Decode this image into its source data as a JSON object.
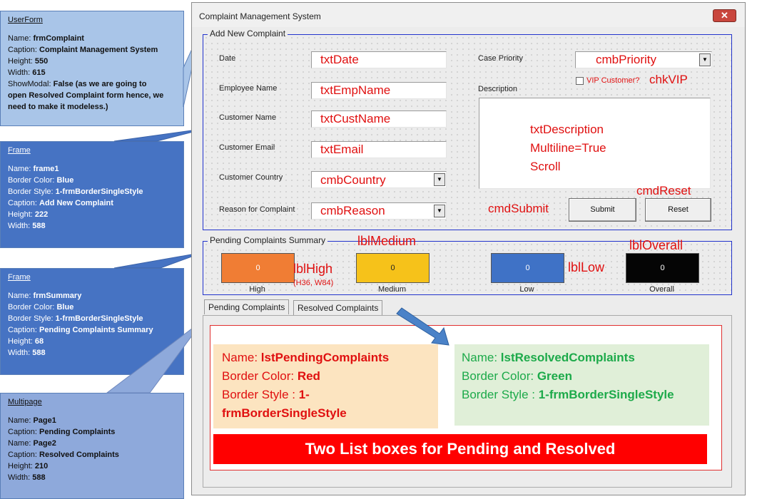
{
  "callouts": {
    "userform": {
      "title": "UserForm",
      "rows": [
        {
          "k": "Name: ",
          "v": "frmComplaint"
        },
        {
          "k": "Caption: ",
          "v": "Complaint Management System"
        },
        {
          "k": "Height: ",
          "v": "550"
        },
        {
          "k": "Width: ",
          "v": "615"
        },
        {
          "k": "ShowModal: ",
          "v": "False (as we are going to"
        },
        {
          "k": "",
          "v": "open Resolved Complaint form hence, we"
        },
        {
          "k": "",
          "v": "need to make it modeless.)"
        }
      ]
    },
    "frame1": {
      "title": "Frame",
      "rows": [
        {
          "k": "Name: ",
          "v": "frame1"
        },
        {
          "k": "Border Color: ",
          "v": "Blue"
        },
        {
          "k": "Border Style: ",
          "v": "1-frmBorderSingleStyle"
        },
        {
          "k": "Caption: ",
          "v": "Add New Complaint"
        },
        {
          "k": "Height:   ",
          "v": "222"
        },
        {
          "k": "Width:   ",
          "v": "588"
        }
      ]
    },
    "frmsummary": {
      "title": "Frame",
      "rows": [
        {
          "k": "Name: ",
          "v": "frmSummary"
        },
        {
          "k": "Border Color: ",
          "v": "Blue"
        },
        {
          "k": "Border Style: ",
          "v": "1-frmBorderSingleStyle"
        },
        {
          "k": "Caption: ",
          "v": "Pending Complaints Summary"
        },
        {
          "k": "Height:   ",
          "v": "68"
        },
        {
          "k": "Width:   ",
          "v": "588"
        }
      ]
    },
    "multipage": {
      "title": "Multipage",
      "rows": [
        {
          "k": "Name: ",
          "v": "Page1"
        },
        {
          "k": "Caption: ",
          "v": "Pending Complaints"
        },
        {
          "k": "Name: ",
          "v": "Page2"
        },
        {
          "k": "Caption: ",
          "v": "Resolved Complaints"
        },
        {
          "k": "Height:   ",
          "v": "210"
        },
        {
          "k": "Width:   ",
          "v": "588"
        }
      ]
    }
  },
  "form": {
    "title": "Complaint Management System",
    "close_symbol": "✕",
    "frame1_caption": "Add New Complaint",
    "labels": {
      "date": "Date",
      "emp": "Employee Name",
      "cust": "Customer Name",
      "email": "Customer Email",
      "country": "Customer Country",
      "reason": "Reason for Complaint",
      "priority": "Case Priority",
      "vip": "VIP Customer?",
      "desc": "Description"
    },
    "controls": {
      "txtDate": "txtDate",
      "txtEmpName": "txtEmpName",
      "txtCustName": "txtCustName",
      "txtEmail": "txtEmail",
      "cmbCountry": "cmbCountry",
      "cmbReason": "cmbReason",
      "cmbPriority": "cmbPriority",
      "chkVIP": "chkVIP",
      "desc_line1": "txtDescription",
      "desc_line2": "Multiline=True",
      "desc_line3": "Scroll",
      "cmdSubmit": "cmdSubmit",
      "cmdReset": "cmdReset"
    },
    "buttons": {
      "submit": "Submit",
      "reset": "Reset"
    },
    "summary": {
      "caption": "Pending Complaints Summary",
      "tiles": [
        {
          "caption": "High",
          "value": "0",
          "color": "#f07d34"
        },
        {
          "caption": "Medium",
          "value": "0",
          "color": "#f6c21a"
        },
        {
          "caption": "Low",
          "value": "0",
          "color": "#3f72c6"
        },
        {
          "caption": "Overall",
          "value": "0",
          "color": "#050505"
        }
      ],
      "annotations": {
        "lblHigh": "lblHigh",
        "lblHigh_size": "(H36, W84)",
        "lblMedium": "lblMedium",
        "lblLow": "lblLow",
        "lblOverall": "lblOverall"
      }
    },
    "tabs": [
      "Pending Complaints",
      "Resolved Complaints"
    ],
    "lists": {
      "pending": {
        "k1": "Name: ",
        "v1": "lstPendingComplaints",
        "k2": "Border Color: ",
        "v2": "Red",
        "k3": "Border Style : ",
        "v3a": "1-",
        "v3b": "frmBorderSingleStyle"
      },
      "resolved": {
        "k1": "Name: ",
        "v1": "lstResolvedComplaints",
        "k2": "Border Color: ",
        "v2": "Green",
        "k3": "Border Style : ",
        "v3": "1-frmBorderSingleStyle"
      },
      "banner": "Two List boxes for Pending and Resolved"
    }
  }
}
